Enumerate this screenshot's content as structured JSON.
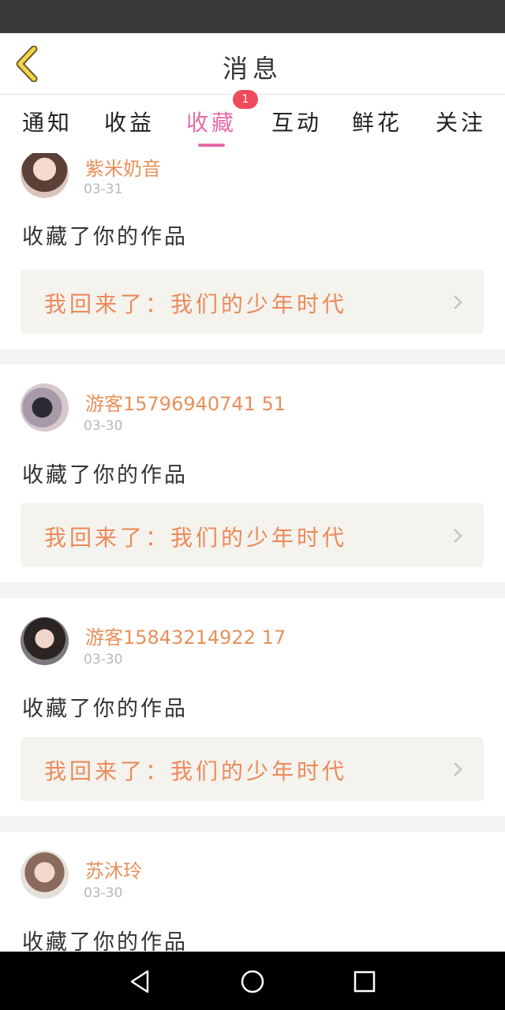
{
  "header": {
    "title": "消息",
    "back_icon": "chevron-left-icon"
  },
  "tabs": [
    {
      "label": "通知"
    },
    {
      "label": "收益"
    },
    {
      "label": "收藏",
      "active": true,
      "badge": "1"
    },
    {
      "label": "互动"
    },
    {
      "label": "鲜花"
    },
    {
      "label": "关注"
    }
  ],
  "messages": [
    {
      "username": "紫米奶音",
      "date": "03-31",
      "action": "收藏了你的作品",
      "work_title": "我回来了：我们的少年时代"
    },
    {
      "username": "游客15796940741 51",
      "date": "03-30",
      "action": "收藏了你的作品",
      "work_title": "我回来了：我们的少年时代"
    },
    {
      "username": "游客15843214922 17",
      "date": "03-30",
      "action": "收藏了你的作品",
      "work_title": "我回来了：我们的少年时代"
    },
    {
      "username": "苏沐玲",
      "date": "03-30",
      "action": "收藏了你的作品",
      "work_title": ""
    }
  ],
  "colors": {
    "accent": "#e86aa6",
    "username": "#e8905a",
    "work_title": "#ec8a5a",
    "badge": "#f04b5a"
  }
}
